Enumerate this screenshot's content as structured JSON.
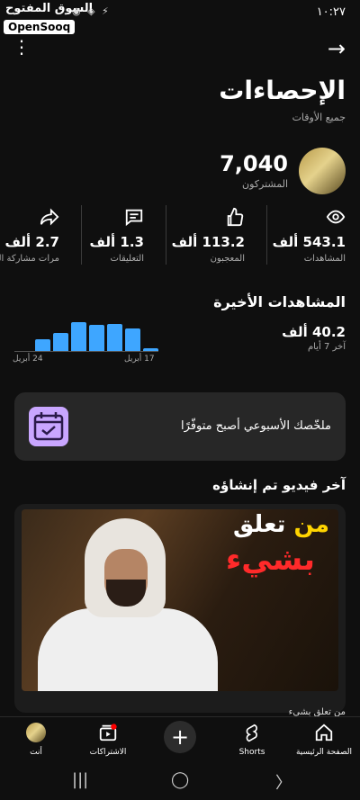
{
  "status_bar": {
    "time": "١٠:٢٧",
    "watermark": "السوق المفتوح",
    "badge": "OpenSooq",
    "indicators": "◉ ◈ ⚡"
  },
  "header": {
    "title": "الإحصاءات",
    "subtitle": "جميع الأوقات",
    "more_icon": "more-vert-icon",
    "forward_icon": "arrow-forward-icon"
  },
  "channel": {
    "subscribers_value": "7,040",
    "subscribers_label": "المشتركون"
  },
  "stats": [
    {
      "icon": "eye-icon",
      "value": "543.1 ألف",
      "label": "المشاهدات"
    },
    {
      "icon": "thumbs-up-icon",
      "value": "113.2 ألف",
      "label": "المعجبون"
    },
    {
      "icon": "comment-icon",
      "value": "1.3 ألف",
      "label": "التعليقات"
    },
    {
      "icon": "share-icon",
      "value": "2.7 ألف",
      "label": "مرات مشاركة الف"
    }
  ],
  "recent_views": {
    "title": "المشاهدات الأخيرة",
    "value": "40.2 ألف",
    "period": "آخر 7 أيام",
    "axis_start": "17 أبريل",
    "axis_end": "24 أبريل"
  },
  "chart_data": {
    "type": "bar",
    "categories": [
      "17 أبريل",
      "",
      "",
      "",
      "",
      "",
      "24 أبريل"
    ],
    "values": [
      0.08,
      0.78,
      0.95,
      0.92,
      1.0,
      0.62,
      0.42
    ],
    "title": "",
    "xlabel": "",
    "ylabel": "",
    "grid": false,
    "accent": "#3ea6ff"
  },
  "weekly_summary": {
    "text": "ملخّصك الأسبوعي أصبح متوفّرًا",
    "icon": "calendar-check-icon"
  },
  "latest_video": {
    "title": "آخر فيديو تم إنشاؤه",
    "overlay_line1_a": "من",
    "overlay_line1_b": "تعلق",
    "overlay_line2": "بشيء",
    "caption": "من تعلق بشيء"
  },
  "bottom_nav": [
    {
      "icon": "home-icon",
      "label": "الصفحة الرئيسية"
    },
    {
      "icon": "shorts-icon",
      "label": "Shorts"
    },
    {
      "icon": "plus-icon",
      "label": "+"
    },
    {
      "icon": "subscriptions-icon",
      "label": "الاشتراكات"
    },
    {
      "icon": "avatar-icon",
      "label": "أنت"
    }
  ],
  "colors": {
    "background": "#0f0f0f",
    "card": "#272727",
    "accent": "#3ea6ff",
    "overlay_red": "#ff2a2a",
    "overlay_yellow": "#ffd400"
  }
}
